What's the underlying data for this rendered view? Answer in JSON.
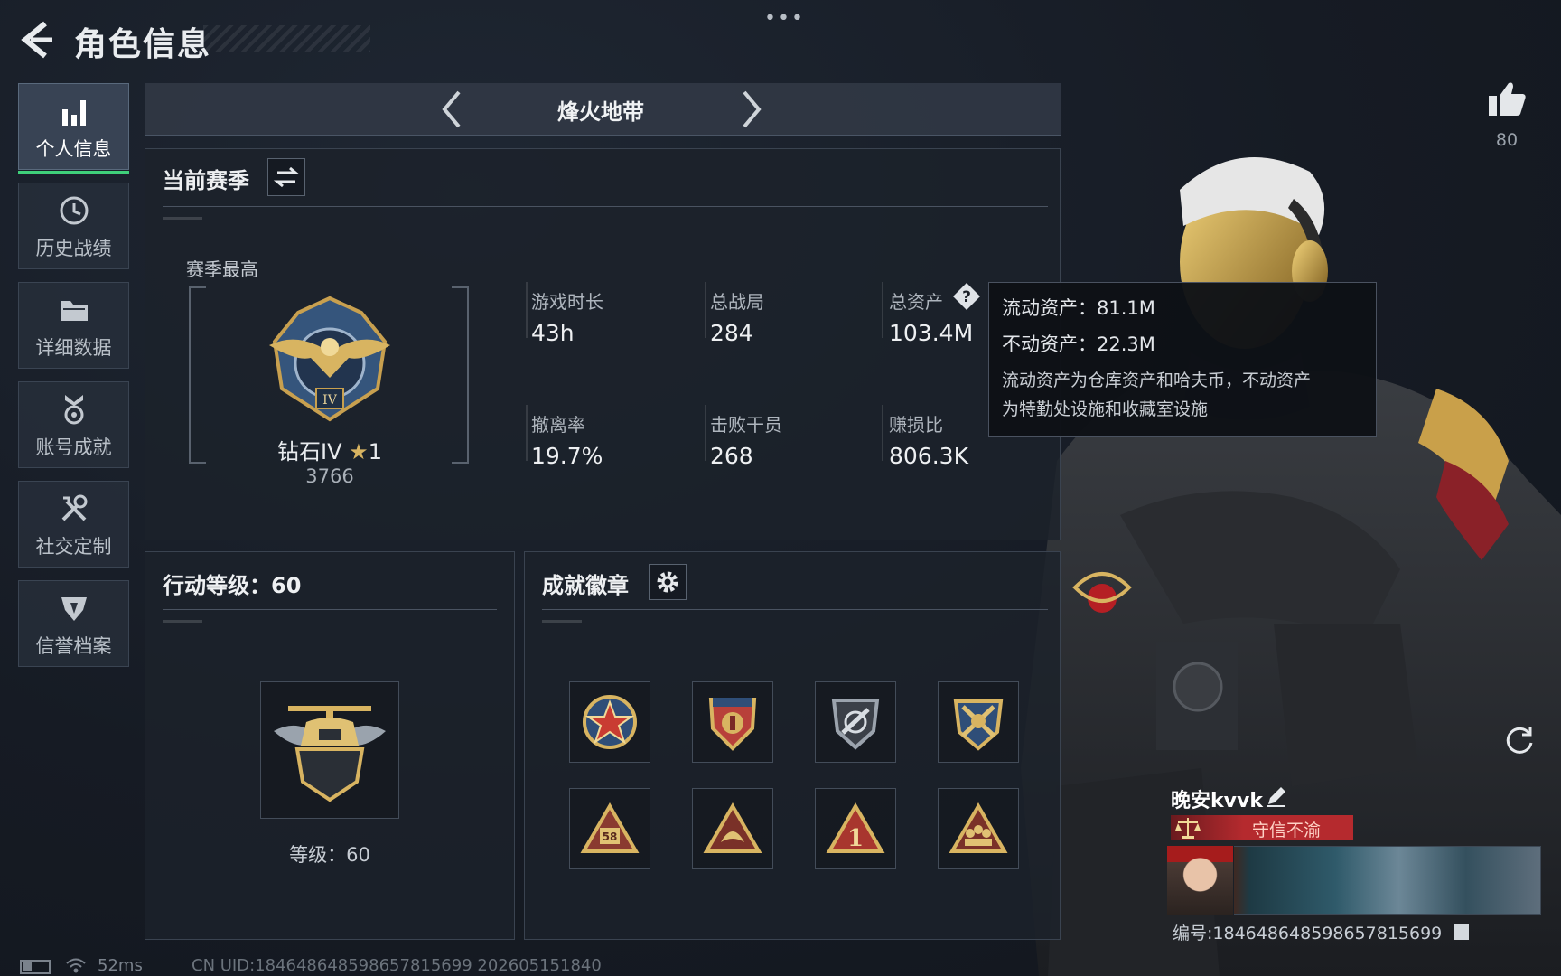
{
  "header": {
    "title": "角色信息",
    "more": "•••"
  },
  "like": {
    "count": "80",
    "icon": "thumbs-up-icon"
  },
  "sidebar": {
    "items": [
      {
        "label": "个人信息",
        "icon": "bar-chart-icon",
        "active": true
      },
      {
        "label": "历史战绩",
        "icon": "clock-icon",
        "active": false
      },
      {
        "label": "详细数据",
        "icon": "folder-icon",
        "active": false
      },
      {
        "label": "账号成就",
        "icon": "medal-icon",
        "active": false
      },
      {
        "label": "社交定制",
        "icon": "tools-icon",
        "active": false
      },
      {
        "label": "信誉档案",
        "icon": "shield-heart-icon",
        "active": false
      }
    ],
    "accent": "#3fd07a"
  },
  "mode": {
    "title": "烽火地带"
  },
  "season": {
    "title": "当前赛季",
    "best_label": "赛季最高",
    "rank_name": "钻石IV",
    "rank_stars": "1",
    "rank_score": "3766",
    "stats": [
      {
        "label": "游戏时长",
        "value": "43h"
      },
      {
        "label": "总战局",
        "value": "284"
      },
      {
        "label": "总资产",
        "value": "103.4M"
      },
      {
        "label": "撤离率",
        "value": "19.7%"
      },
      {
        "label": "击败干员",
        "value": "268"
      },
      {
        "label": "赚损比",
        "value": "806.3K"
      }
    ]
  },
  "tooltip": {
    "liquid": "流动资产：81.1M",
    "fixed": "不动资产：22.3M",
    "note_line1": "流动资产为仓库资产和哈夫币，不动资产",
    "note_line2": "为特勤处设施和收藏室设施"
  },
  "level": {
    "title": "行动等级：60",
    "text": "等级：60"
  },
  "badges": {
    "title": "成就徽章",
    "items": [
      "star-medal-icon",
      "eagle-shield-icon",
      "rifle-shield-icon",
      "crossed-guns-shield-icon",
      "triangle-58-icon",
      "triangle-crest-icon",
      "triangle-one-icon",
      "triangle-squad-icon"
    ]
  },
  "player": {
    "name": "晚安kvvk",
    "reputation": "守信不渝",
    "uid": "编号:1846486485986578156​99"
  },
  "status": {
    "ping": "52ms",
    "uid_footer": "CN UID:1846486485986578156​99 202605151840"
  }
}
